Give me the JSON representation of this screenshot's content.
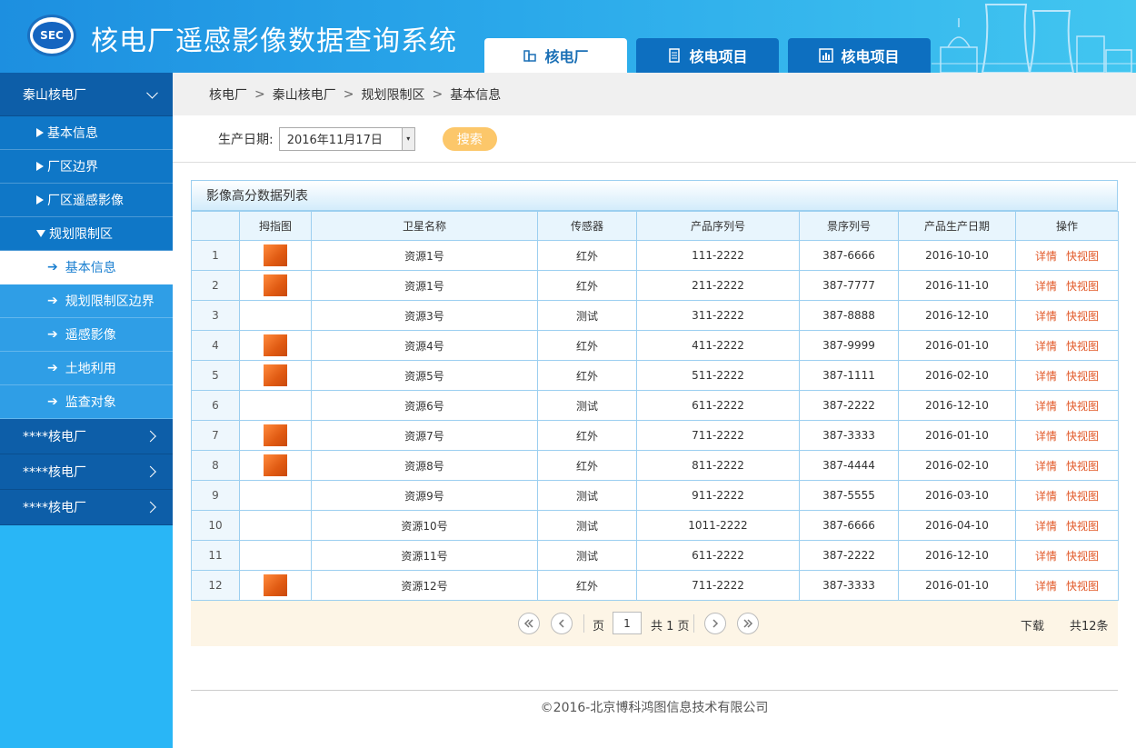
{
  "header": {
    "logo_text": "SEC",
    "title": "核电厂遥感影像数据查询系统",
    "tabs": [
      {
        "label": "核电厂",
        "icon": "building-icon",
        "active": true
      },
      {
        "label": "核电项目",
        "icon": "document-icon",
        "active": false
      },
      {
        "label": "核电项目",
        "icon": "bar-chart-icon",
        "active": false
      }
    ]
  },
  "sidebar": {
    "plant1": "秦山核电厂",
    "sub": [
      "基本信息",
      "厂区边界",
      "厂区遥感影像",
      "规划限制区"
    ],
    "subsub": [
      "基本信息",
      "规划限制区边界",
      "遥感影像",
      "土地利用",
      "监查对象"
    ],
    "others": [
      "****核电厂",
      "****核电厂",
      "****核电厂"
    ]
  },
  "breadcrumb": [
    "核电厂",
    "秦山核电厂",
    "规划限制区",
    "基本信息"
  ],
  "filter": {
    "label": "生产日期:",
    "date": "2016年11月17日",
    "search": "搜索"
  },
  "table": {
    "title": "影像高分数据列表",
    "headers": [
      "",
      "拇指图",
      "卫星名称",
      "传感器",
      "产品序列号",
      "景序列号",
      "产品生产日期",
      "操作"
    ],
    "rows": [
      {
        "idx": "1",
        "thumb": true,
        "name": "资源1号",
        "sensor": "红外",
        "pid": "111-2222",
        "sid": "387-6666",
        "date": "2016-10-10"
      },
      {
        "idx": "2",
        "thumb": true,
        "name": "资源1号",
        "sensor": "红外",
        "pid": "211-2222",
        "sid": "387-7777",
        "date": "2016-11-10"
      },
      {
        "idx": "3",
        "thumb": false,
        "name": "资源3号",
        "sensor": "测试",
        "pid": "311-2222",
        "sid": "387-8888",
        "date": "2016-12-10"
      },
      {
        "idx": "4",
        "thumb": true,
        "name": "资源4号",
        "sensor": "红外",
        "pid": "411-2222",
        "sid": "387-9999",
        "date": "2016-01-10"
      },
      {
        "idx": "5",
        "thumb": true,
        "name": "资源5号",
        "sensor": "红外",
        "pid": "511-2222",
        "sid": "387-1111",
        "date": "2016-02-10"
      },
      {
        "idx": "6",
        "thumb": false,
        "name": "资源6号",
        "sensor": "测试",
        "pid": "611-2222",
        "sid": "387-2222",
        "date": "2016-12-10"
      },
      {
        "idx": "7",
        "thumb": true,
        "name": "资源7号",
        "sensor": "红外",
        "pid": "711-2222",
        "sid": "387-3333",
        "date": "2016-01-10"
      },
      {
        "idx": "8",
        "thumb": true,
        "name": "资源8号",
        "sensor": "红外",
        "pid": "811-2222",
        "sid": "387-4444",
        "date": "2016-02-10"
      },
      {
        "idx": "9",
        "thumb": false,
        "name": "资源9号",
        "sensor": "测试",
        "pid": "911-2222",
        "sid": "387-5555",
        "date": "2016-03-10"
      },
      {
        "idx": "10",
        "thumb": false,
        "name": "资源10号",
        "sensor": "测试",
        "pid": "1011-2222",
        "sid": "387-6666",
        "date": "2016-04-10"
      },
      {
        "idx": "11",
        "thumb": false,
        "name": "资源11号",
        "sensor": "测试",
        "pid": "611-2222",
        "sid": "387-2222",
        "date": "2016-12-10"
      },
      {
        "idx": "12",
        "thumb": true,
        "name": "资源12号",
        "sensor": "红外",
        "pid": "711-2222",
        "sid": "387-3333",
        "date": "2016-01-10"
      }
    ],
    "op_detail": "详情",
    "op_quick": "快视图"
  },
  "pager": {
    "page_label": "页",
    "page_value": "1",
    "total_pages": "共 1 页",
    "download": "下载",
    "total_items": "共12条"
  },
  "footer": "©2016-北京博科鸿图信息技术有限公司"
}
